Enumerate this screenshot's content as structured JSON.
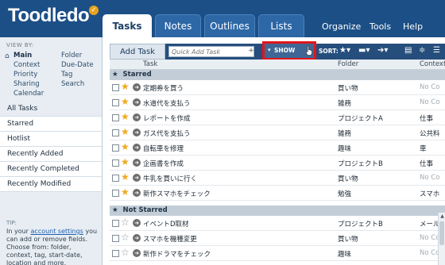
{
  "app": {
    "logo": "Toodledo"
  },
  "tabs": [
    {
      "label": "Tasks",
      "active": true
    },
    {
      "label": "Notes",
      "active": false
    },
    {
      "label": "Outlines",
      "active": false
    },
    {
      "label": "Lists",
      "active": false
    }
  ],
  "top_nav": [
    "Organize",
    "Tools",
    "Help"
  ],
  "sidebar": {
    "viewby_label": "VIEW BY:",
    "viewby_left": [
      "Main",
      "Context",
      "Priority",
      "Sharing",
      "Calendar"
    ],
    "viewby_right": [
      "Folder",
      "Due-Date",
      "Tag",
      "Search"
    ],
    "items": [
      {
        "label": "All Tasks",
        "active": true
      },
      {
        "label": "Starred",
        "active": false
      },
      {
        "label": "Hotlist",
        "active": false
      },
      {
        "label": "Recently Added",
        "active": false
      },
      {
        "label": "Recently Completed",
        "active": false
      },
      {
        "label": "Recently Modified",
        "active": false
      }
    ],
    "tip_label": "TIP:",
    "tip_prefix": "In your ",
    "tip_link": "account settings",
    "tip_suffix": " you can add or remove fields. Choose from: folder, context, tag, start-date, location and more."
  },
  "toolbar": {
    "add_task": "Add Task",
    "quick_add_placeholder": "Quick Add Task",
    "quick_add_plus": "+",
    "show_label": "SHOW",
    "sort_label": "SORT:"
  },
  "columns": {
    "task": "Task",
    "folder": "Folder",
    "context": "Context"
  },
  "sections": {
    "starred": "Starred",
    "not_starred": "Not Starred"
  },
  "starred_tasks": [
    {
      "task": "定期券を買う",
      "folder": "買い物",
      "context": "No Co"
    },
    {
      "task": "水道代を支払う",
      "folder": "雑務",
      "context": "No Co"
    },
    {
      "task": "レポートを作成",
      "folder": "プロジェクトA",
      "context": "仕事"
    },
    {
      "task": "ガス代を支払う",
      "folder": "雑務",
      "context": "公共料"
    },
    {
      "task": "自転車を修理",
      "folder": "趣味",
      "context": "車"
    },
    {
      "task": "企画書を作成",
      "folder": "プロジェクトB",
      "context": "仕事"
    },
    {
      "task": "牛乳を買いに行く",
      "folder": "買い物",
      "context": "No Co"
    },
    {
      "task": "新作スマホをチェック",
      "folder": "勉強",
      "context": "スマホ"
    }
  ],
  "not_starred_tasks": [
    {
      "task": "イベントD取材",
      "folder": "プロジェクトB",
      "context": "メール"
    },
    {
      "task": "スマホを機種変更",
      "folder": "買い物",
      "context": "No Co"
    },
    {
      "task": "新作ドラマをチェック",
      "folder": "趣味",
      "context": "No Co"
    }
  ]
}
